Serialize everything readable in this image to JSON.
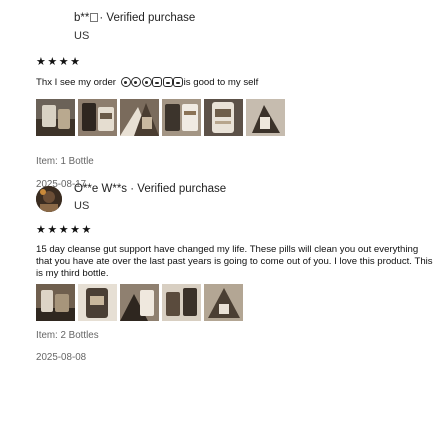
{
  "reviews": [
    {
      "reviewer": "b**",
      "badge": "Verified purchase",
      "separator": "·",
      "country": "US",
      "stars": "★★★★",
      "rating": 4,
      "text_prefix": "Thx I see my order",
      "text_suffix": "is good to my self",
      "item": "Item: 1 Bottle",
      "date": "2025-08-17"
    },
    {
      "reviewer": "O**e W**s",
      "badge": "Verified purchase",
      "separator": "·",
      "country": "US",
      "stars": "★★★★★",
      "rating": 5,
      "text": "15 day cleanse gut support have changed my life. These pills will clean you out everything that you have ate over the last past years is going to come out of you. I love this product. This is my third bottle.",
      "item": "Item: 2 Bottles",
      "date": "2025-08-08"
    }
  ]
}
